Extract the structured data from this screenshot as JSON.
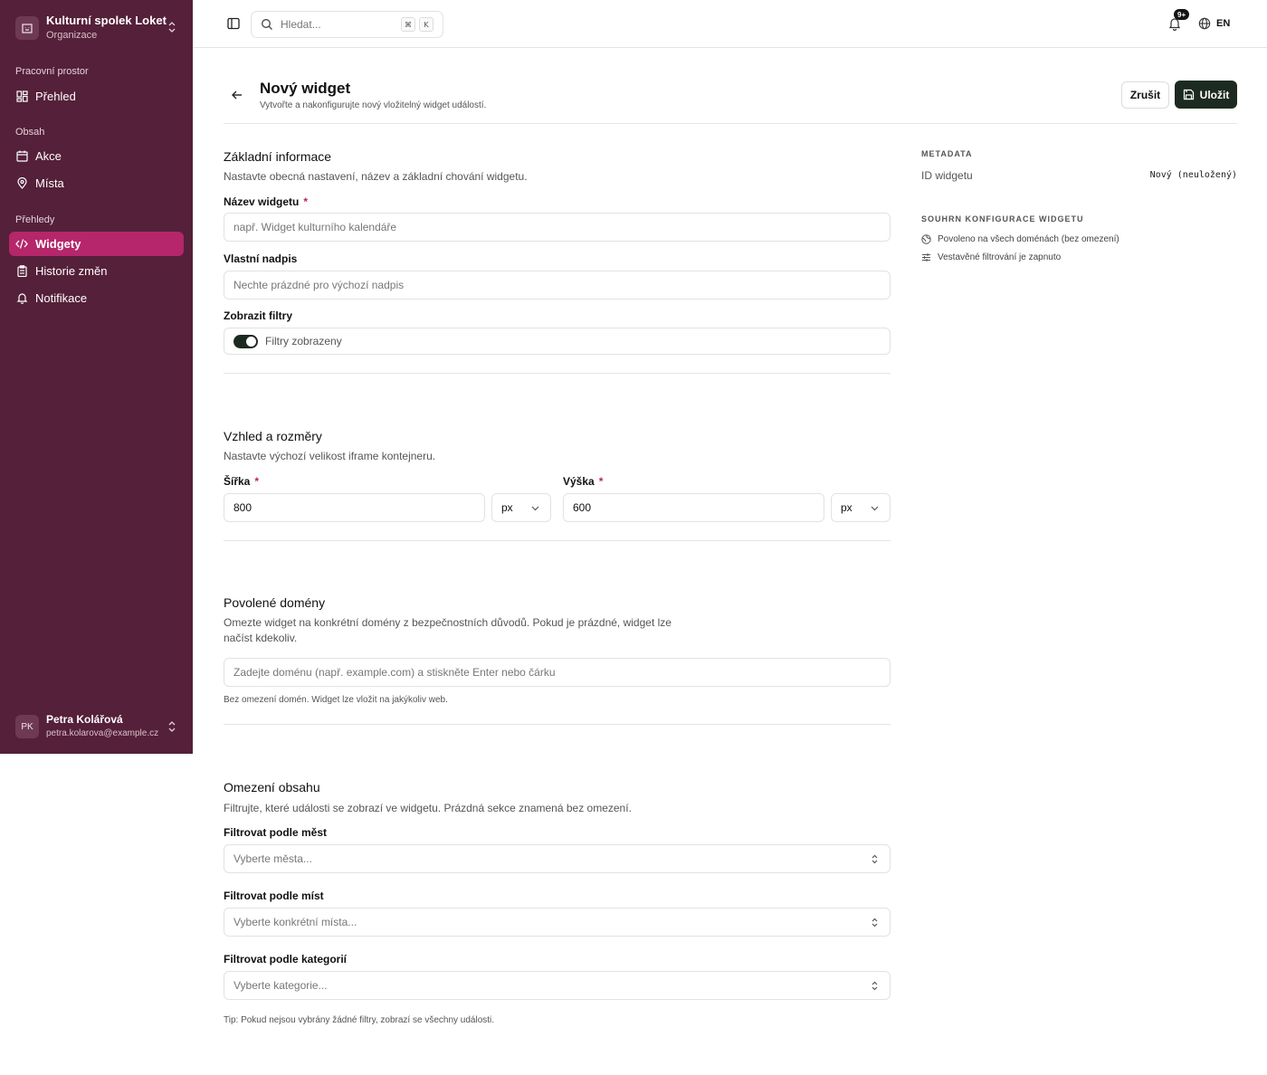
{
  "sidebar": {
    "org_name": "Kulturní spolek Loket",
    "org_sub": "Organizace",
    "sections": [
      {
        "label": "Pracovní prostor"
      },
      {
        "label": "Obsah"
      },
      {
        "label": "Přehledy"
      }
    ],
    "items": [
      {
        "label": "Přehled",
        "icon": "dashboard-icon"
      },
      {
        "label": "Akce",
        "icon": "calendar-icon"
      },
      {
        "label": "Místa",
        "icon": "map-pin-icon"
      },
      {
        "label": "Widgety",
        "icon": "code-icon",
        "active": true
      },
      {
        "label": "Historie změn",
        "icon": "clipboard-icon"
      },
      {
        "label": "Notifikace",
        "icon": "bell-icon"
      }
    ],
    "user": {
      "initials": "PK",
      "name": "Petra Kolářová",
      "email": "petra.kolarova@example.cz"
    }
  },
  "topbar": {
    "search_placeholder": "Hledat...",
    "kbd1": "⌘",
    "kbd2": "K",
    "notif_badge": "9+",
    "lang": "EN"
  },
  "header": {
    "title": "Nový widget",
    "subtitle": "Vytvořte a nakonfigurujte nový vložitelný widget událostí.",
    "cancel": "Zrušit",
    "save": "Uložit"
  },
  "basic": {
    "title": "Základní informace",
    "desc": "Nastavte obecná nastavení, název a základní chování widgetu.",
    "name_label": "Název widgetu",
    "name_placeholder": "např. Widget kulturního kalendáře",
    "heading_label": "Vlastní nadpis",
    "heading_placeholder": "Nechte prázdné pro výchozí nadpis",
    "filters_label": "Zobrazit filtry",
    "filters_value": "Filtry zobrazeny"
  },
  "size": {
    "title": "Vzhled a rozměry",
    "desc": "Nastavte výchozí velikost iframe kontejneru.",
    "width_label": "Šířka",
    "width_value": "800",
    "width_unit": "px",
    "height_label": "Výška",
    "height_value": "600",
    "height_unit": "px"
  },
  "domains": {
    "title": "Povolené domény",
    "desc1": "Omezte widget na konkrétní domény z bezpečnostních důvodů. Pokud je prázdné, widget lze",
    "desc2": "načíst kdekoliv.",
    "placeholder": "Zadejte doménu (např. example.com) a stiskněte Enter nebo čárku",
    "hint": "Bez omezení domén. Widget lze vložit na jakýkoliv web."
  },
  "content": {
    "title": "Omezení obsahu",
    "desc": "Filtrujte, které události se zobrazí ve widgetu. Prázdná sekce znamená bez omezení.",
    "cities_label": "Filtrovat podle měst",
    "cities_placeholder": "Vyberte města...",
    "places_label": "Filtrovat podle míst",
    "places_placeholder": "Vyberte konkrétní místa...",
    "cats_label": "Filtrovat podle kategorií",
    "cats_placeholder": "Vyberte kategorie...",
    "tip": "Tip: Pokud nejsou vybrány žádné filtry, zobrazí se všechny události."
  },
  "meta": {
    "label": "METADATA",
    "id_key": "ID widgetu",
    "id_val": "Nový (neuložený)",
    "summary_label": "SOUHRN KONFIGURACE WIDGETU",
    "summary1": "Povoleno na všech doménách (bez omezení)",
    "summary2": "Vestavěné filtrování je zapnuto"
  }
}
